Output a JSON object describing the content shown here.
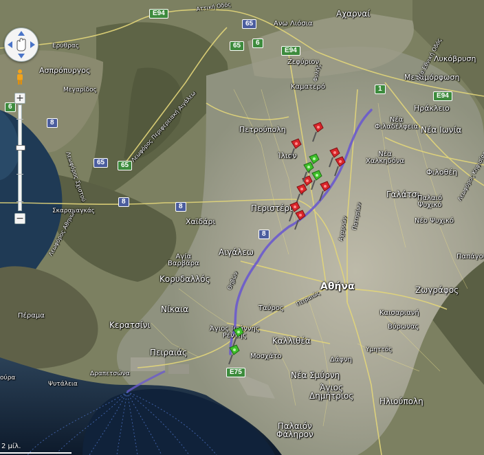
{
  "map": {
    "places": {
      "acharnai": "Αχαρναί",
      "ano_liosia": "Ανω Λιόσια",
      "zefyrion": "Ζεφύριον",
      "kamatero": "Καματερό",
      "metamorfosi": "Μεταμόρφωση",
      "lykovrysi": "Λυκόβρυση",
      "aspropyrgos": "Ασπρόπυργος",
      "megaridos": "Μεγαρίδος",
      "irakleio": "Ηράκλειο",
      "nea_filadelfeia": "Νέα\nΦιλαδέλφεια",
      "nea_ionia": "Νέα Ιωνία",
      "petroupoli": "Πετρούπολη",
      "ilion": "Ίλιον",
      "nea_chalkidona": "Νέα\nΧαλκηδόνα",
      "filothei": "Φιλοθέη",
      "galatsi": "Γαλάτσι",
      "palaio_psychiko": "Παλαιό\nΨυχικό",
      "neo_psychiko": "Νέο Ψυχικό",
      "skaramangas": "Σκαραμαγκάς",
      "chaidari": "Χαϊδάρι",
      "peristeri": "Περιστέρι",
      "aigaleo": "Αιγάλεω",
      "agia_varvara": "Αγία\nΒαρβάρα",
      "korydallos": "Κορυδαλλός",
      "athina": "Αθήνα",
      "zografos": "Ζωγράφος",
      "papagou": "Παπάγου",
      "nikaia": "Νίκαια",
      "tavros": "Ταύρος",
      "kaisariani": "Καισαριανή",
      "vyronas": "Βύρωνας",
      "perama": "Πέραμα",
      "keratsini": "Κερατσίνι",
      "agios_ioannis_rentis": "Άγιος Ιωάννης\nΡέντης",
      "kallithea": "Καλλιθέα",
      "ymittos": "Υμηττός",
      "pireas": "Πειραιάς",
      "moschato": "Μοσχάτο",
      "dafni": "Δάφνη",
      "drapetsona": "Δραπετσώνα",
      "nea_smyrni": "Νέα Σμύρνη",
      "agios_dimitrios": "Άγιος\nΔημήτριος",
      "ilioupoli": "Ηλιούπολη",
      "psytaleia": "Ψυτάλεια",
      "palaio_faliro": "Παλαιόν\nΦάληρον",
      "erythras": "Ερύθρας",
      "oura": "ούρα"
    },
    "roads": {
      "attiki_odos": "Αττική Οδός",
      "lefkon_perifereiakos": "Λεωφόρος Περιφερειακή Αιγάλεω",
      "lefkon_schistou": "Λεωφόρος Σχιστού",
      "lefkon_athinon": "Λεωφόρος Αθηνών",
      "thivon": "Θηβών",
      "fylis": "Φυλής",
      "acharnon": "Αχαρνών",
      "patission": "Πατησίων",
      "peiraios": "Πειραιώς",
      "kifisias": "Λεωφόρος Κηφισίας",
      "nea_ethniki": "Νέα Εθνική Οδός"
    },
    "shields": {
      "e94_a": "E94",
      "e94_b": "E94",
      "e94_c": "E94",
      "r65_a": "65",
      "r65_b": "65",
      "r65_c": "65",
      "r65_d": "65",
      "r6": "6",
      "r1": "1",
      "r8_a": "8",
      "r8_b": "8",
      "r8_c": "8",
      "r8_d": "8",
      "r6_west": "6",
      "e75": "E75"
    },
    "scale_label": "2 μίλ."
  },
  "controls": {
    "zoom_in": "+",
    "zoom_out": "−"
  },
  "colors": {
    "route": "#6a5acd",
    "pin_red": "#d8262a",
    "pin_green": "#3fbf2a",
    "shield_green": "#3d8b3d",
    "shield_blue": "#4b5d9e"
  },
  "icons": [
    "pan-control-icon",
    "pegman-icon",
    "red-pushpin-icon",
    "green-pushpin-icon"
  ]
}
